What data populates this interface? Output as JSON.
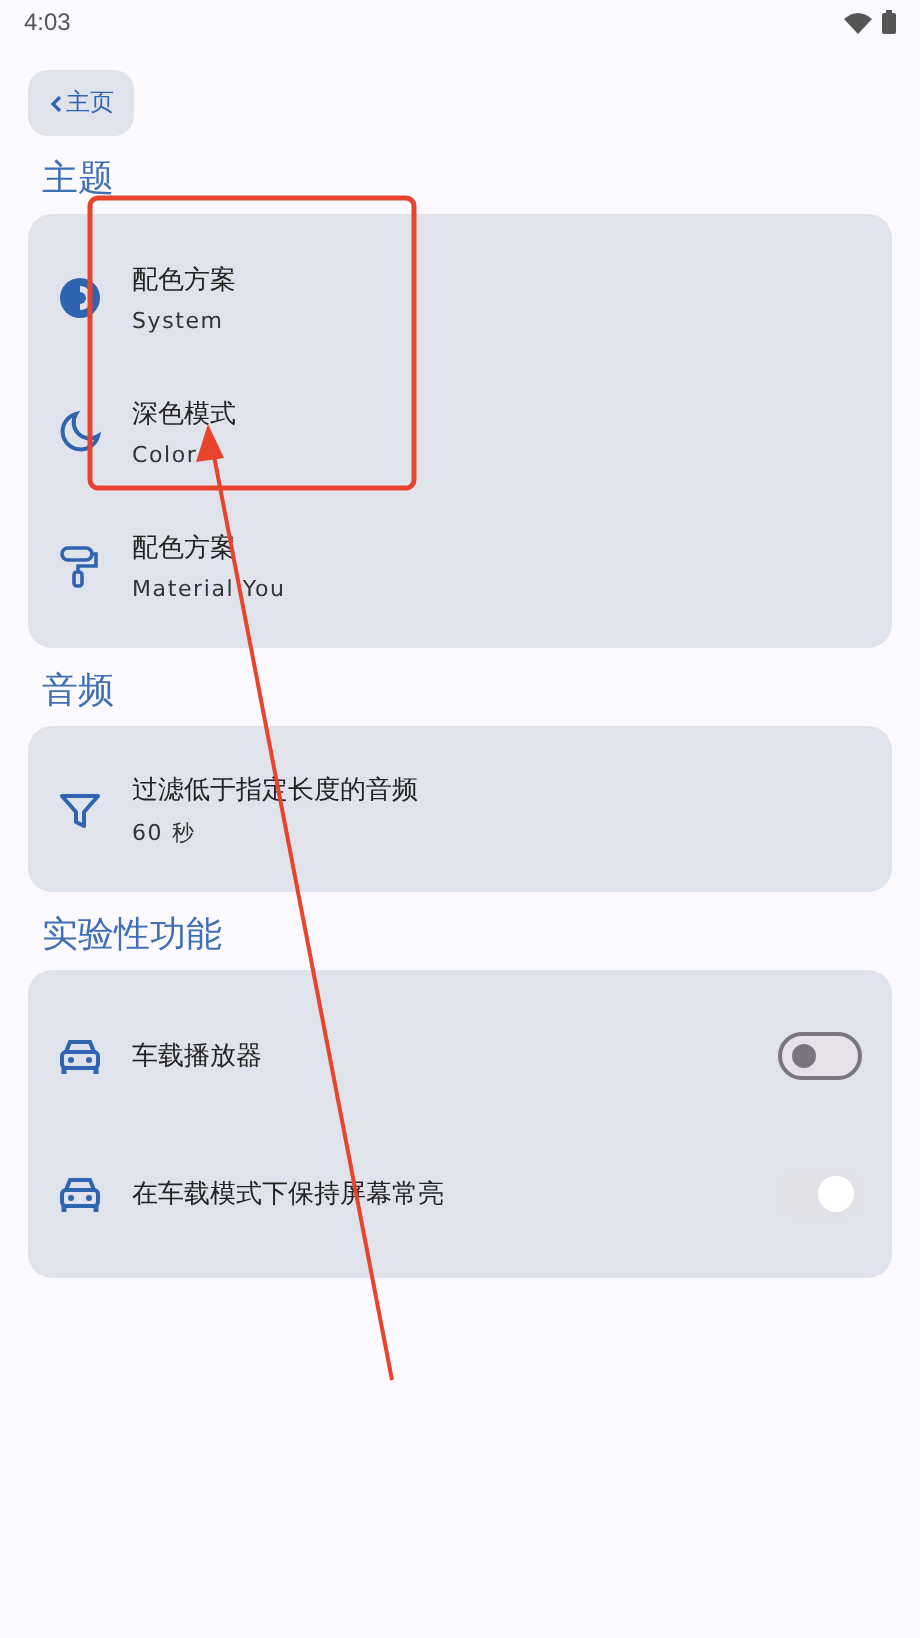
{
  "status_bar": {
    "time": "4:03"
  },
  "back_button": {
    "label": "主页"
  },
  "sections": [
    {
      "title": "主题",
      "rows": [
        {
          "kind": "text",
          "title": "配色方案",
          "subtitle": "System"
        },
        {
          "kind": "text",
          "title": "深色模式",
          "subtitle": "Color"
        },
        {
          "kind": "text",
          "title": "配色方案",
          "subtitle": "Material You"
        }
      ]
    },
    {
      "title": "音频",
      "rows": [
        {
          "kind": "text",
          "title": "过滤低于指定长度的音频",
          "subtitle": "60 秒"
        }
      ]
    },
    {
      "title": "实验性功能",
      "rows": [
        {
          "kind": "switch",
          "title": "车载播放器",
          "on": false,
          "disabled": false
        },
        {
          "kind": "switch",
          "title": "在车载模式下保持屏幕常亮",
          "on": true,
          "disabled": true
        }
      ]
    }
  ]
}
